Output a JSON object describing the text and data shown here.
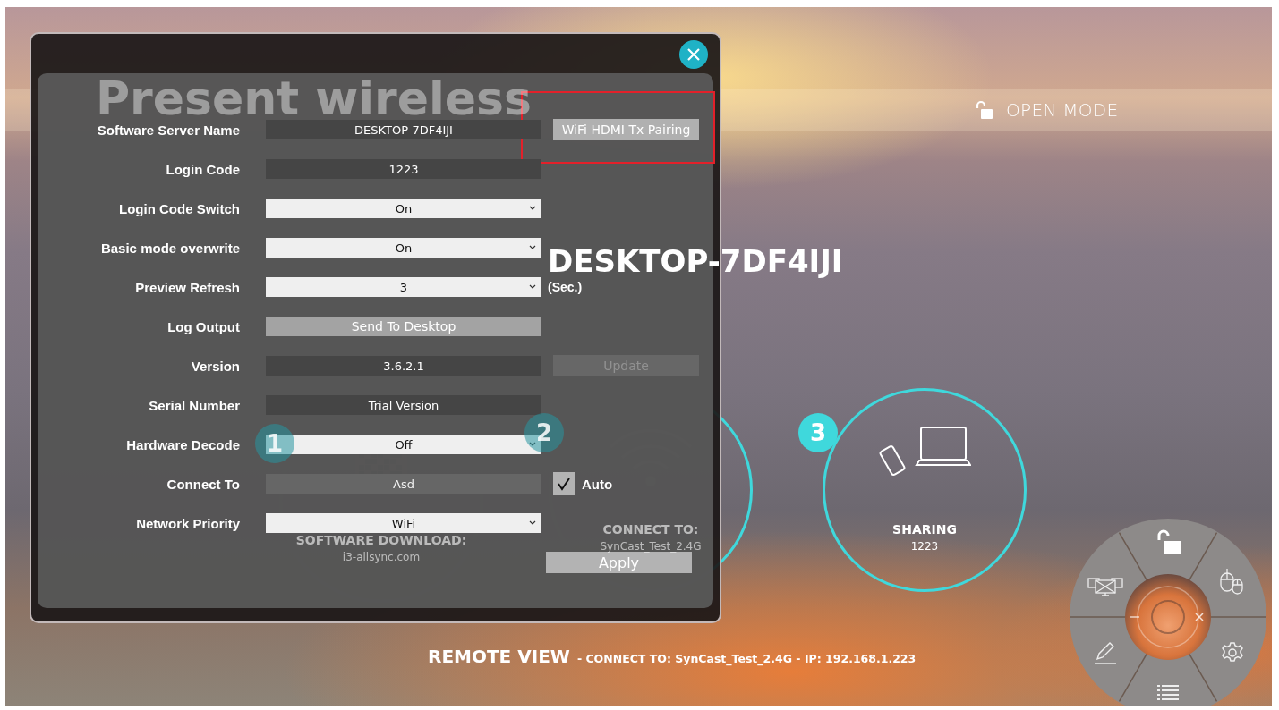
{
  "top_bar": {
    "mode": "OPEN MODE"
  },
  "backdrop": {
    "heading": "Present wireless",
    "host_name": "DESKTOP-7DF4IJI"
  },
  "steps": [
    {
      "number": "1",
      "kind": "download",
      "title": "SOFTWARE DOWNLOAD:",
      "detail": "i3-allsync.com"
    },
    {
      "number": "2",
      "kind": "wifi",
      "title": "CONNECT TO:",
      "detail": "SynCast_Test_2.4G"
    },
    {
      "number": "3",
      "kind": "sharing",
      "title": "SHARING",
      "detail": "1223"
    }
  ],
  "settings": {
    "rows": [
      {
        "label": "Software Server Name",
        "kind": "text",
        "value": "DESKTOP-7DF4IJI",
        "action": {
          "kind": "button",
          "label": "WiFi HDMI Tx Pairing",
          "disabled": false,
          "highlighted": true
        }
      },
      {
        "label": "Login Code",
        "kind": "text",
        "value": "1223"
      },
      {
        "label": "Login Code Switch",
        "kind": "select",
        "value": "On"
      },
      {
        "label": "Basic mode overwrite",
        "kind": "select",
        "value": "On"
      },
      {
        "label": "Preview Refresh",
        "kind": "select",
        "value": "3",
        "action": {
          "kind": "unit",
          "label": "(Sec.)"
        }
      },
      {
        "label": "Log Output",
        "kind": "button",
        "value": "Send To Desktop"
      },
      {
        "label": "Version",
        "kind": "text",
        "value": "3.6.2.1",
        "action": {
          "kind": "button",
          "label": "Update",
          "disabled": true,
          "highlighted": false
        }
      },
      {
        "label": "Serial Number",
        "kind": "text",
        "value": "Trial Version"
      },
      {
        "label": "Hardware Decode",
        "kind": "select",
        "value": "Off"
      },
      {
        "label": "Connect To",
        "kind": "text",
        "value": "Asd",
        "disabled": true,
        "action": {
          "kind": "checkbox",
          "label": "Auto",
          "checked": true
        }
      },
      {
        "label": "Network Priority",
        "kind": "select",
        "value": "WiFi"
      }
    ],
    "apply": "Apply"
  },
  "footer": {
    "title": "REMOTE VIEW",
    "detail": "- CONNECT TO: SynCast_Test_2.4G - IP: 192.168.1.223"
  }
}
